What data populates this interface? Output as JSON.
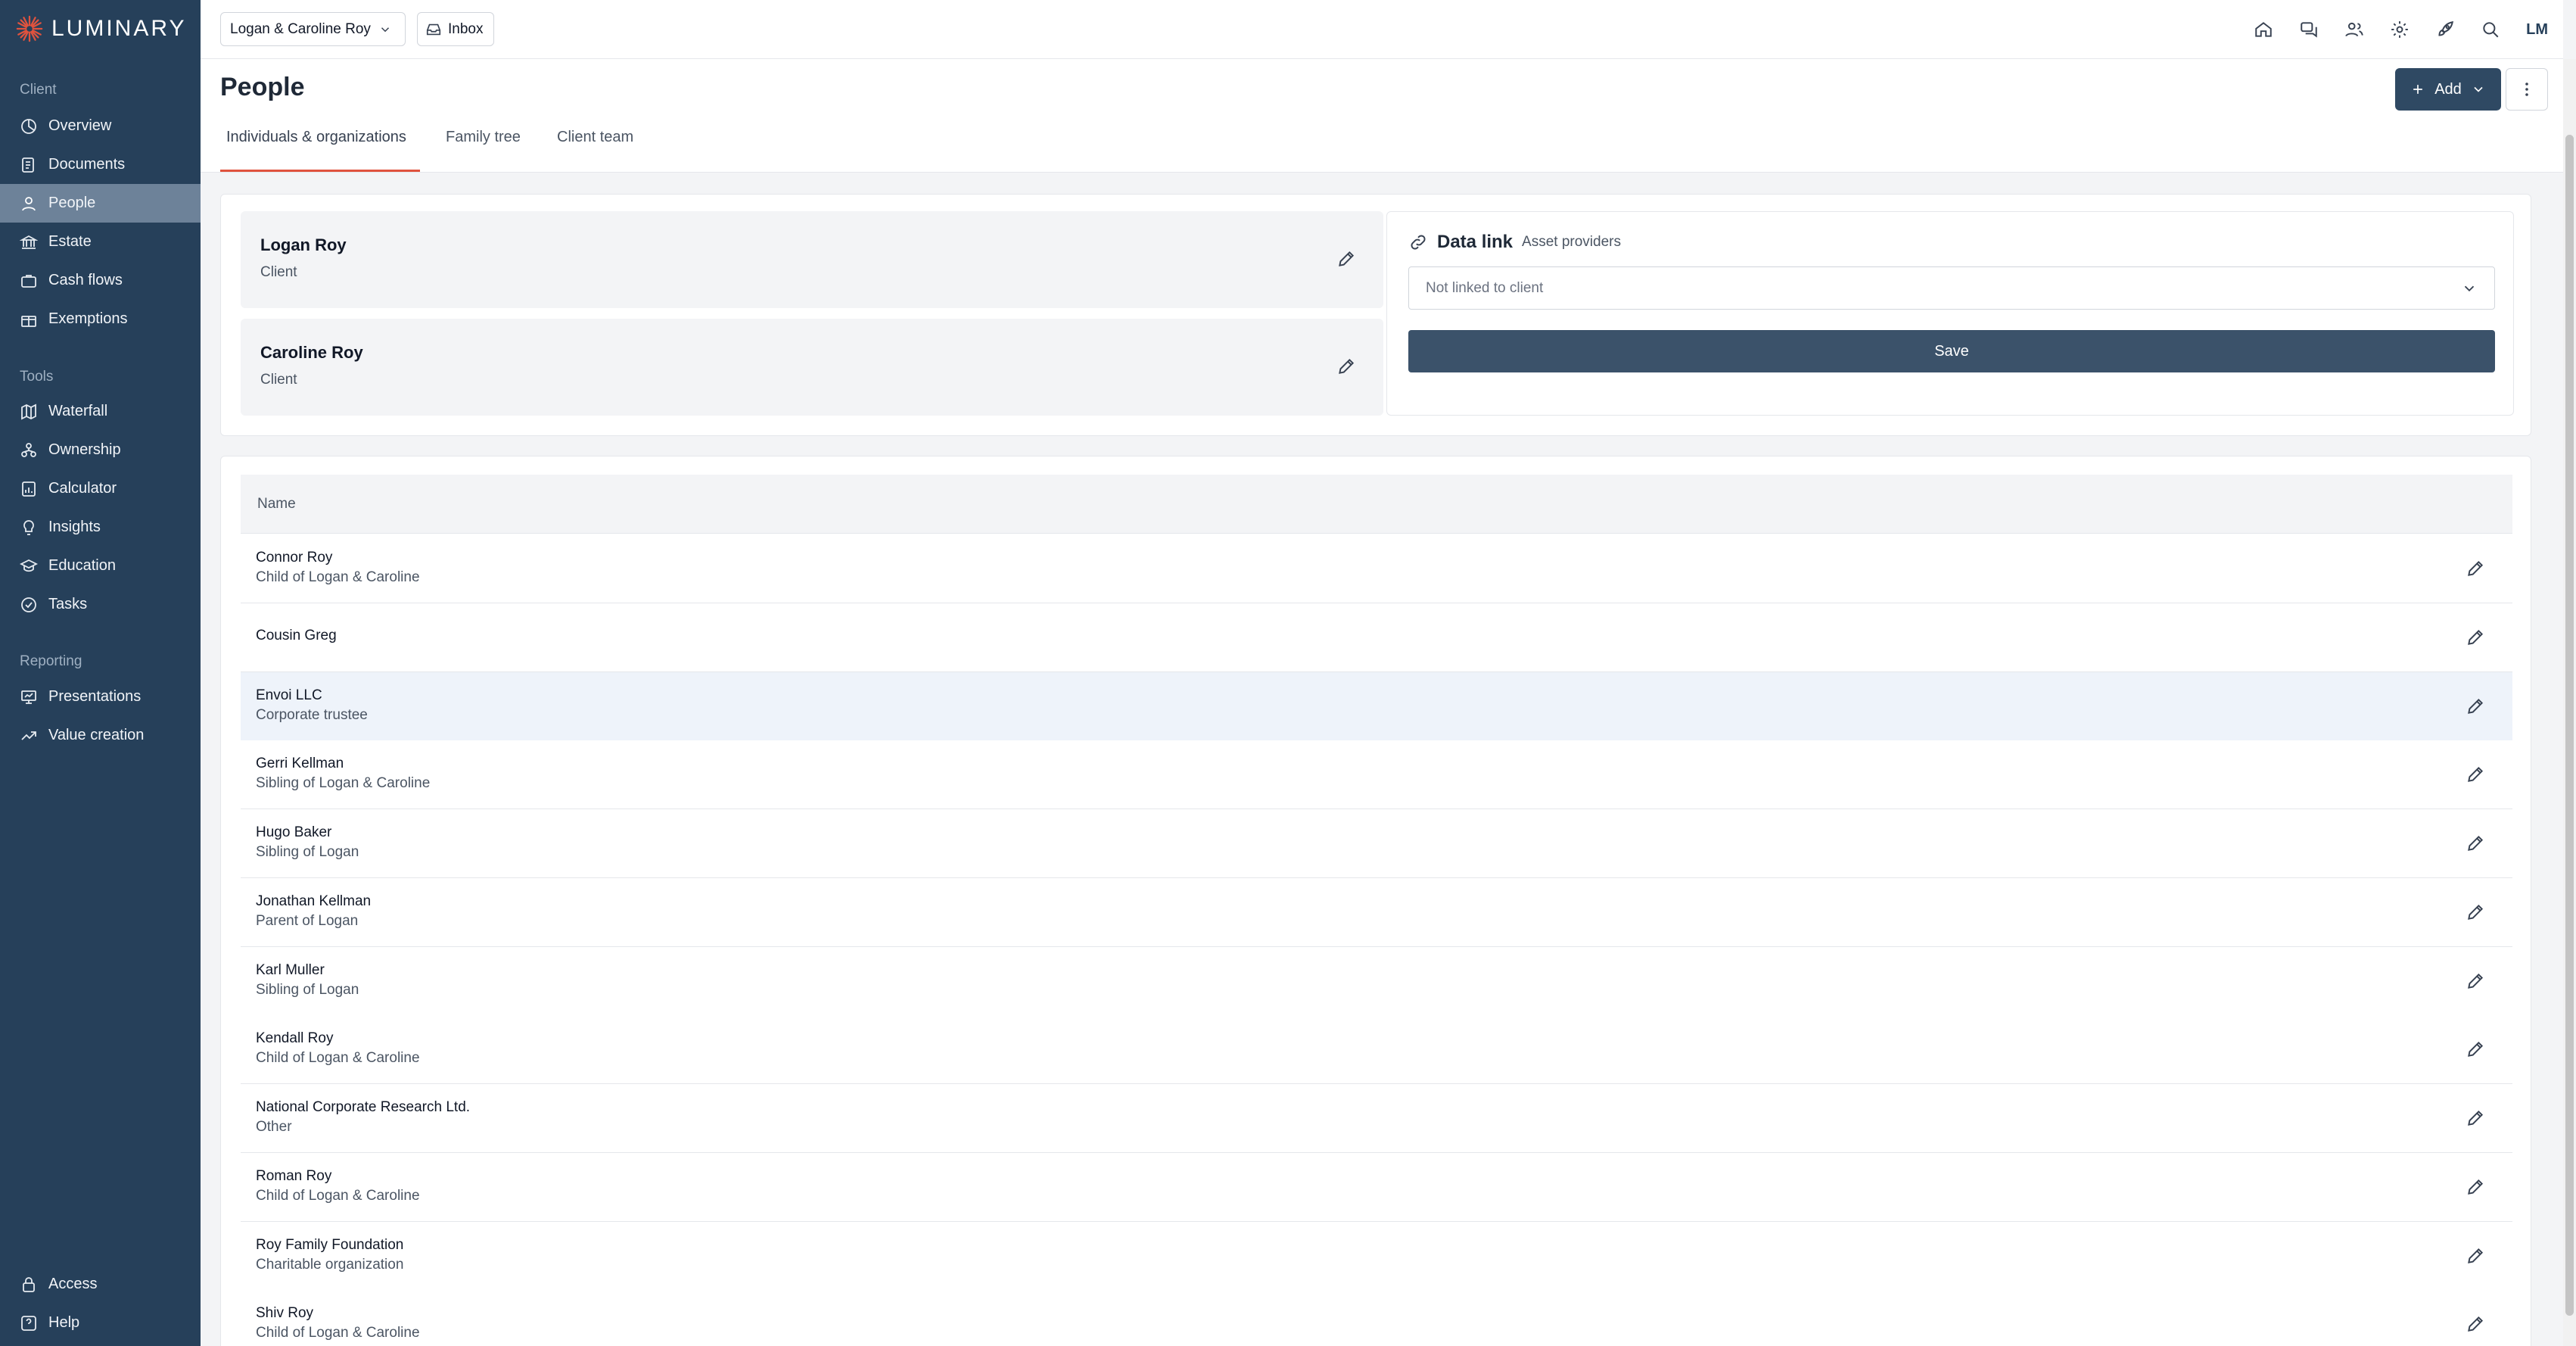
{
  "brand": {
    "name": "LUMINARY",
    "accent": "#e0533e",
    "sidebar_bg": "#26405a"
  },
  "sidebar": {
    "sections": [
      {
        "title": "Client",
        "items": [
          {
            "label": "Overview",
            "icon": "chart-pie-icon"
          },
          {
            "label": "Documents",
            "icon": "document-icon"
          },
          {
            "label": "People",
            "icon": "user-icon",
            "active": true
          },
          {
            "label": "Estate",
            "icon": "bank-icon"
          },
          {
            "label": "Cash flows",
            "icon": "briefcase-icon"
          },
          {
            "label": "Exemptions",
            "icon": "gift-icon"
          }
        ]
      },
      {
        "title": "Tools",
        "items": [
          {
            "label": "Waterfall",
            "icon": "map-icon"
          },
          {
            "label": "Ownership",
            "icon": "hierarchy-icon"
          },
          {
            "label": "Calculator",
            "icon": "calculator-icon"
          },
          {
            "label": "Insights",
            "icon": "lightbulb-icon"
          },
          {
            "label": "Education",
            "icon": "graduation-cap-icon"
          },
          {
            "label": "Tasks",
            "icon": "check-circle-icon"
          }
        ]
      },
      {
        "title": "Reporting",
        "items": [
          {
            "label": "Presentations",
            "icon": "presentation-icon"
          },
          {
            "label": "Value creation",
            "icon": "trend-up-icon"
          }
        ]
      }
    ],
    "footer": [
      {
        "label": "Access",
        "icon": "lock-icon"
      },
      {
        "label": "Help",
        "icon": "help-icon"
      }
    ]
  },
  "topbar": {
    "client_selector": "Logan & Caroline Roy",
    "inbox_label": "Inbox",
    "icons": [
      "home-icon",
      "messages-icon",
      "users-icon",
      "settings-icon",
      "rocket-icon",
      "search-icon"
    ],
    "user_initials": "LM"
  },
  "page": {
    "title": "People",
    "add_label": "Add",
    "tabs": [
      "Individuals & organizations",
      "Family tree",
      "Client team"
    ],
    "active_tab": 0
  },
  "clients": [
    {
      "name": "Logan Roy",
      "role": "Client"
    },
    {
      "name": "Caroline Roy",
      "role": "Client"
    }
  ],
  "data_link": {
    "title": "Data link",
    "subtitle": "Asset providers",
    "select_placeholder": "Not linked to client",
    "save_label": "Save"
  },
  "table": {
    "header": "Name",
    "rows": [
      {
        "name": "Connor Roy",
        "relation": "Child of Logan & Caroline"
      },
      {
        "name": "Cousin Greg",
        "relation": ""
      },
      {
        "name": "Envoi LLC",
        "relation": "Corporate trustee"
      },
      {
        "name": "Gerri Kellman",
        "relation": "Sibling of Logan & Caroline"
      },
      {
        "name": "Hugo Baker",
        "relation": "Sibling of Logan"
      },
      {
        "name": "Jonathan Kellman",
        "relation": "Parent of Logan"
      },
      {
        "name": "Karl Muller",
        "relation": "Sibling of Logan"
      },
      {
        "name": "Kendall Roy",
        "relation": "Child of Logan & Caroline"
      },
      {
        "name": "National Corporate Research Ltd.",
        "relation": "Other"
      },
      {
        "name": "Roman Roy",
        "relation": "Child of Logan & Caroline"
      },
      {
        "name": "Roy Family Foundation",
        "relation": "Charitable organization"
      },
      {
        "name": "Shiv Roy",
        "relation": "Child of Logan & Caroline"
      }
    ]
  }
}
